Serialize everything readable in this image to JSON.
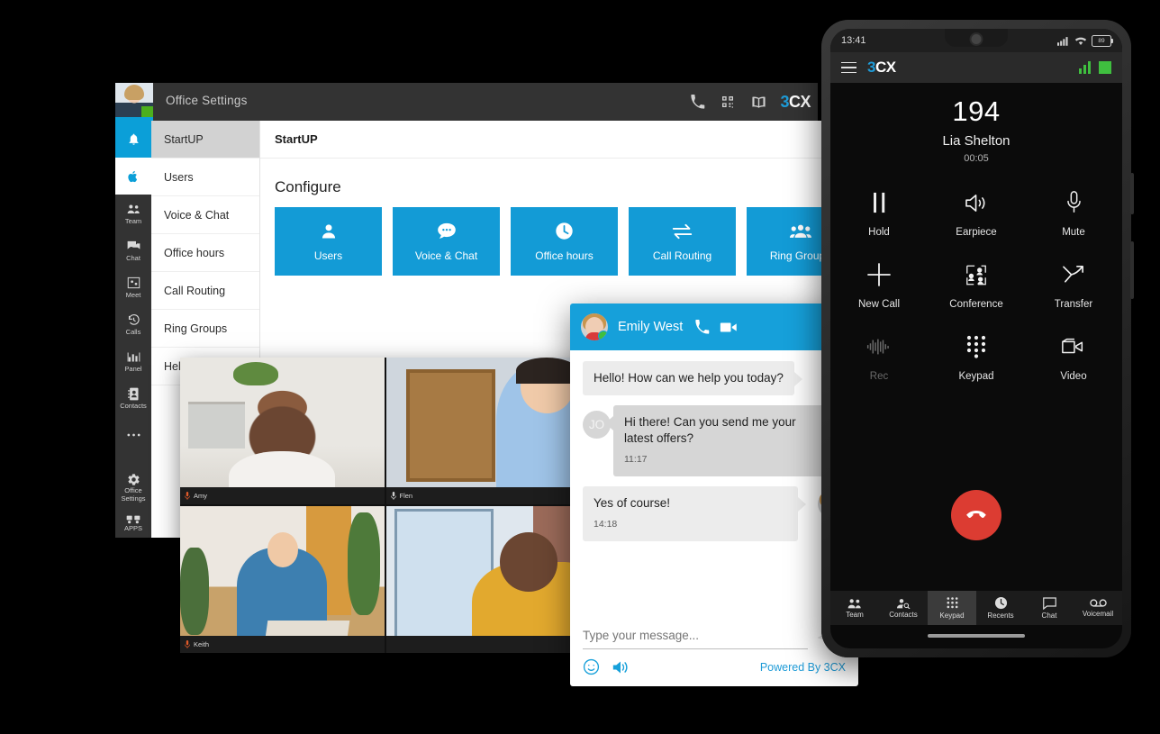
{
  "desktop": {
    "title": "Office Settings",
    "avatar_name": "user-avatar",
    "header_icons": [
      "phone-icon",
      "qr-code-icon",
      "book-icon"
    ],
    "logo": {
      "prefix": "3",
      "suffix": "CX"
    },
    "rail": [
      {
        "name": "notifications",
        "label": "",
        "icon": "bell-icon",
        "active": true
      },
      {
        "name": "apple",
        "label": "",
        "icon": "apple-icon",
        "active": false
      },
      {
        "name": "team",
        "label": "Team",
        "icon": "team-icon"
      },
      {
        "name": "chat",
        "label": "Chat",
        "icon": "chat-icon"
      },
      {
        "name": "meet",
        "label": "Meet",
        "icon": "meet-icon"
      },
      {
        "name": "calls",
        "label": "Calls",
        "icon": "calls-history-icon"
      },
      {
        "name": "panel",
        "label": "Panel",
        "icon": "panel-chart-icon"
      },
      {
        "name": "contacts",
        "label": "Contacts",
        "icon": "contacts-icon"
      },
      {
        "name": "more",
        "label": "",
        "icon": "more-dots-icon"
      }
    ],
    "rail_bottom": [
      {
        "name": "office-settings",
        "label": "Office\nSettings",
        "line1": "Office",
        "line2": "Settings",
        "icon": "gear-icon"
      },
      {
        "name": "apps",
        "label": "APPS",
        "icon": "apps-icon"
      }
    ],
    "menu": [
      {
        "label": "StartUP",
        "selected": true
      },
      {
        "label": "Users",
        "selected": false
      },
      {
        "label": "Voice & Chat",
        "selected": false
      },
      {
        "label": "Office hours",
        "selected": false
      },
      {
        "label": "Call Routing",
        "selected": false
      },
      {
        "label": "Ring Groups",
        "selected": false
      },
      {
        "label": "Help",
        "selected": false
      }
    ],
    "content_header": "StartUP",
    "configure_title": "Configure",
    "tiles": [
      {
        "label": "Users",
        "icon": "person-icon"
      },
      {
        "label": "Voice & Chat",
        "icon": "chat-bubble-icon"
      },
      {
        "label": "Office hours",
        "icon": "clock-icon"
      },
      {
        "label": "Call Routing",
        "icon": "transfer-arrows-icon"
      },
      {
        "label": "Ring Groups",
        "icon": "group-icon"
      }
    ],
    "accent": "#139bd6"
  },
  "video": {
    "participants": [
      {
        "name": "Amy",
        "mic": "mic-muted-icon",
        "selected": false
      },
      {
        "name": "Flen",
        "mic": "mic-icon",
        "selected": true
      },
      {
        "name": "Keith",
        "mic": "mic-muted-icon",
        "selected": false
      },
      {
        "name": "",
        "mic": "mic-icon",
        "selected": false
      }
    ]
  },
  "chat_widget": {
    "contact_name": "Emily West",
    "header_icons": [
      "call-icon",
      "video-icon",
      "close-icon"
    ],
    "messages": [
      {
        "side": "agent",
        "text": "Hello! How can we help you today?",
        "time": "",
        "avatar": ""
      },
      {
        "side": "customer",
        "text": "Hi there! Can you send me your latest offers?",
        "time": "11:17",
        "avatar": "JO"
      },
      {
        "side": "me",
        "text": "Yes of course!",
        "time": "14:18",
        "avatar": "emily-avatar"
      }
    ],
    "input_placeholder": "Type your message...",
    "footer_icons": [
      "emoji-icon",
      "sound-icon",
      "send-icon"
    ],
    "powered_by": "Powered By 3CX",
    "accent": "#16a0da"
  },
  "phone": {
    "status": {
      "time": "13:41",
      "battery": "89",
      "icons": [
        "signal-icon",
        "wifi-icon",
        "battery-icon"
      ]
    },
    "appbar": {
      "logo_prefix": "3",
      "logo_suffix": "CX",
      "menu_icon": "hamburger-icon",
      "right_icons": [
        "signal-bars-icon",
        "status-square-icon"
      ]
    },
    "call": {
      "number": "194",
      "caller": "Lia Shelton",
      "duration": "00:05"
    },
    "buttons": [
      {
        "label": "Hold",
        "icon": "pause-icon",
        "disabled": false
      },
      {
        "label": "Earpiece",
        "icon": "speaker-icon",
        "disabled": false
      },
      {
        "label": "Mute",
        "icon": "microphone-icon",
        "disabled": false
      },
      {
        "label": "New Call",
        "icon": "plus-icon",
        "disabled": false
      },
      {
        "label": "Conference",
        "icon": "conference-icon",
        "disabled": false
      },
      {
        "label": "Transfer",
        "icon": "transfer-icon",
        "disabled": false
      },
      {
        "label": "Rec",
        "icon": "waveform-icon",
        "disabled": true
      },
      {
        "label": "Keypad",
        "icon": "dialpad-icon",
        "disabled": false
      },
      {
        "label": "Video",
        "icon": "video-camera-icon",
        "disabled": false
      }
    ],
    "hangup": "hangup-icon",
    "nav": [
      {
        "label": "Team",
        "icon": "team-icon",
        "active": false
      },
      {
        "label": "Contacts",
        "icon": "contacts-search-icon",
        "active": false
      },
      {
        "label": "Keypad",
        "icon": "dialpad-icon",
        "active": true
      },
      {
        "label": "Recents",
        "icon": "clock-icon",
        "active": false
      },
      {
        "label": "Chat",
        "icon": "chat-icon",
        "active": false
      },
      {
        "label": "Voicemail",
        "icon": "voicemail-icon",
        "active": false
      }
    ]
  }
}
